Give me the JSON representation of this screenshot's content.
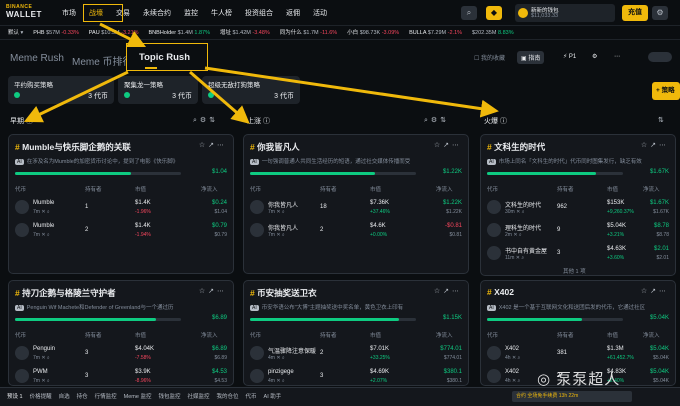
{
  "brand": {
    "top": "BINANCE",
    "bottom": "WALLET"
  },
  "nav": [
    "市场",
    "战壕",
    "交易",
    "永续合约",
    "监控",
    "牛人榜",
    "投资组合",
    "返佣",
    "活动"
  ],
  "wallet": {
    "name": "新新的钱包",
    "value": "$11,033.33"
  },
  "topup_label": "充值",
  "ticker": [
    {
      "name": "默认",
      "val": "",
      "chg": ""
    },
    {
      "name": "PHB",
      "val": "$57M",
      "chg": "-0.33%"
    },
    {
      "name": "PAU",
      "val": "$10.5M",
      "chg": "-3.21%"
    },
    {
      "name": "BNBHolder",
      "val": "$1.4M",
      "chg": "1.87%"
    },
    {
      "name": "增址",
      "val": "$1.42M",
      "chg": "-3.48%"
    },
    {
      "name": "同为什么",
      "val": "$1.7M",
      "chg": "-11.6%"
    },
    {
      "name": "小白",
      "val": "$98.73K",
      "chg": "-3.09%"
    },
    {
      "name": "BULLA",
      "val": "$7.29M",
      "chg": "-2.1%"
    },
    {
      "name": "",
      "val": "$202.35M",
      "chg": "8.83%"
    }
  ],
  "subtabs": {
    "meme_rush": "Meme Rush",
    "meme_board": "Meme 币排行",
    "topic_rush": "Topic Rush"
  },
  "right_controls": {
    "fav": "我的收藏",
    "guide": "指南",
    "p1": "P1"
  },
  "strategies": [
    {
      "name": "平约购买策略",
      "value": "3 代币"
    },
    {
      "name": "聚集龙一策略",
      "value": "3 代币"
    },
    {
      "name": "超级无敌打狗策略",
      "value": "3 代币"
    }
  ],
  "create_label": "策略",
  "columns": {
    "early": "早期",
    "rising": "上涨",
    "hot": "火爆"
  },
  "table_head": {
    "token": "代币",
    "holders": "持有者",
    "volume": "市值",
    "netflow": "净流入"
  },
  "cards": [
    {
      "title": "Mumble与快乐脚企鹅的关联",
      "age": "7m",
      "desc": "在涉及名为Mumble的加密货币讨论中，提到了电影《快乐脚》",
      "bar_val": "$1.04",
      "tokens": [
        {
          "name": "Mumble",
          "age": "7m",
          "holders": "1",
          "price": "$1.4K",
          "pchg": "-1.96%",
          "net": "$0.24",
          "net2": "$1.04"
        },
        {
          "name": "Mumble",
          "age": "7m",
          "holders": "2",
          "price": "$1.4K",
          "pchg": "-1.94%",
          "net": "$0.79",
          "net2": "$0.79"
        }
      ]
    },
    {
      "title": "你我皆凡人",
      "age": "7m",
      "desc": "一句强调普通人共同生活经历的短语，通过社交媒体传播而受",
      "bar_val": "$1.22K",
      "tokens": [
        {
          "name": "你我皆凡人",
          "age": "7m",
          "holders": "18",
          "price": "$7.36K",
          "pchg": "+37.46%",
          "net": "$1.22K",
          "net2": "$1.22K"
        },
        {
          "name": "你我皆凡人",
          "age": "7m",
          "holders": "2",
          "price": "$4.6K",
          "pchg": "+0.00%",
          "net": "-$0.81",
          "net2": "$0.81"
        }
      ]
    },
    {
      "title": "文科生的时代",
      "age": "30m",
      "desc": "市场上同名「文科生的时代」代币同时图集发行，缺乏有效",
      "bar_val": "$1.67K",
      "tokens": [
        {
          "name": "文科生的时代",
          "age": "30m",
          "holders": "962",
          "price": "$153K",
          "pchg": "+9,260.37%",
          "net": "$1.67K",
          "net2": "$1.67K"
        },
        {
          "name": "理科生的时代",
          "age": "2m",
          "holders": "9",
          "price": "$5.04K",
          "pchg": "+3.21%",
          "net": "$8.78",
          "net2": "$8.78"
        },
        {
          "name": "书中自有黄金屋",
          "age": "11m",
          "holders": "3",
          "price": "$4.63K",
          "pchg": "+3.60%",
          "net": "$2.01",
          "net2": "$2.01"
        }
      ],
      "more": "其他 1 项"
    },
    {
      "title": "持刀企鹅与格陵兰守护者",
      "age": "7m",
      "desc": "Penguin Wif Machete和Defender of Greenland与一个通过历",
      "bar_val": "$6.89",
      "tokens": [
        {
          "name": "Penguin",
          "age": "7m",
          "holders": "3",
          "price": "$4.04K",
          "pchg": "-7.58%",
          "net": "$6.89",
          "net2": "$6.89"
        },
        {
          "name": "PWM",
          "age": "7m",
          "holders": "3",
          "price": "$3.9K",
          "pchg": "-8.96%",
          "net": "$4.53",
          "net2": "$4.53"
        }
      ]
    },
    {
      "title": "币安抽奖送卫衣",
      "age": "4m",
      "desc": "币安华语公布\"大博\"主题抽奖送中奖名单，黄色卫衣上印有",
      "bar_val": "$1.15K",
      "tokens": [
        {
          "name": "气温骤降注意保暖",
          "age": "4m",
          "holders": "2",
          "price": "$7.01K",
          "pchg": "+33.25%",
          "net": "$774.01",
          "net2": "$774.01"
        },
        {
          "name": "pinzigege",
          "age": "4m",
          "holders": "3",
          "price": "$4.69K",
          "pchg": "+2.07%",
          "net": "$380.1",
          "net2": "$380.1"
        }
      ]
    },
    {
      "title": "X402",
      "age": "4h",
      "desc": "X402 是一个基于互联网文化和送团后发的代币，它通过社区",
      "bar_val": "$5.04K",
      "tokens": [
        {
          "name": "X402",
          "age": "4h",
          "holders": "381",
          "price": "$1.3M",
          "pchg": "+61,452.7%",
          "net": "$5.04K",
          "net2": "$5.04K"
        },
        {
          "name": "X402",
          "age": "4h",
          "holders": "2",
          "price": "$4.83K",
          "pchg": "+2.40%",
          "net": "$5.04K",
          "net2": "$5.04K"
        }
      ]
    }
  ],
  "bottom": [
    "预设 1",
    "价格提醒",
    "自选",
    "持仓",
    "行情监控",
    "Meme 监控",
    "钱包监控",
    "社媒监控",
    "我的仓位",
    "代币",
    "AI 助手"
  ],
  "promo": "合约 全场免手续费 13h 22m",
  "watermark": "泵泵超人",
  "colors": {
    "accent": "#f0b90b",
    "up": "#0ecb81",
    "down": "#f6465d",
    "bg": "#0b0e11",
    "card": "#14171c"
  }
}
